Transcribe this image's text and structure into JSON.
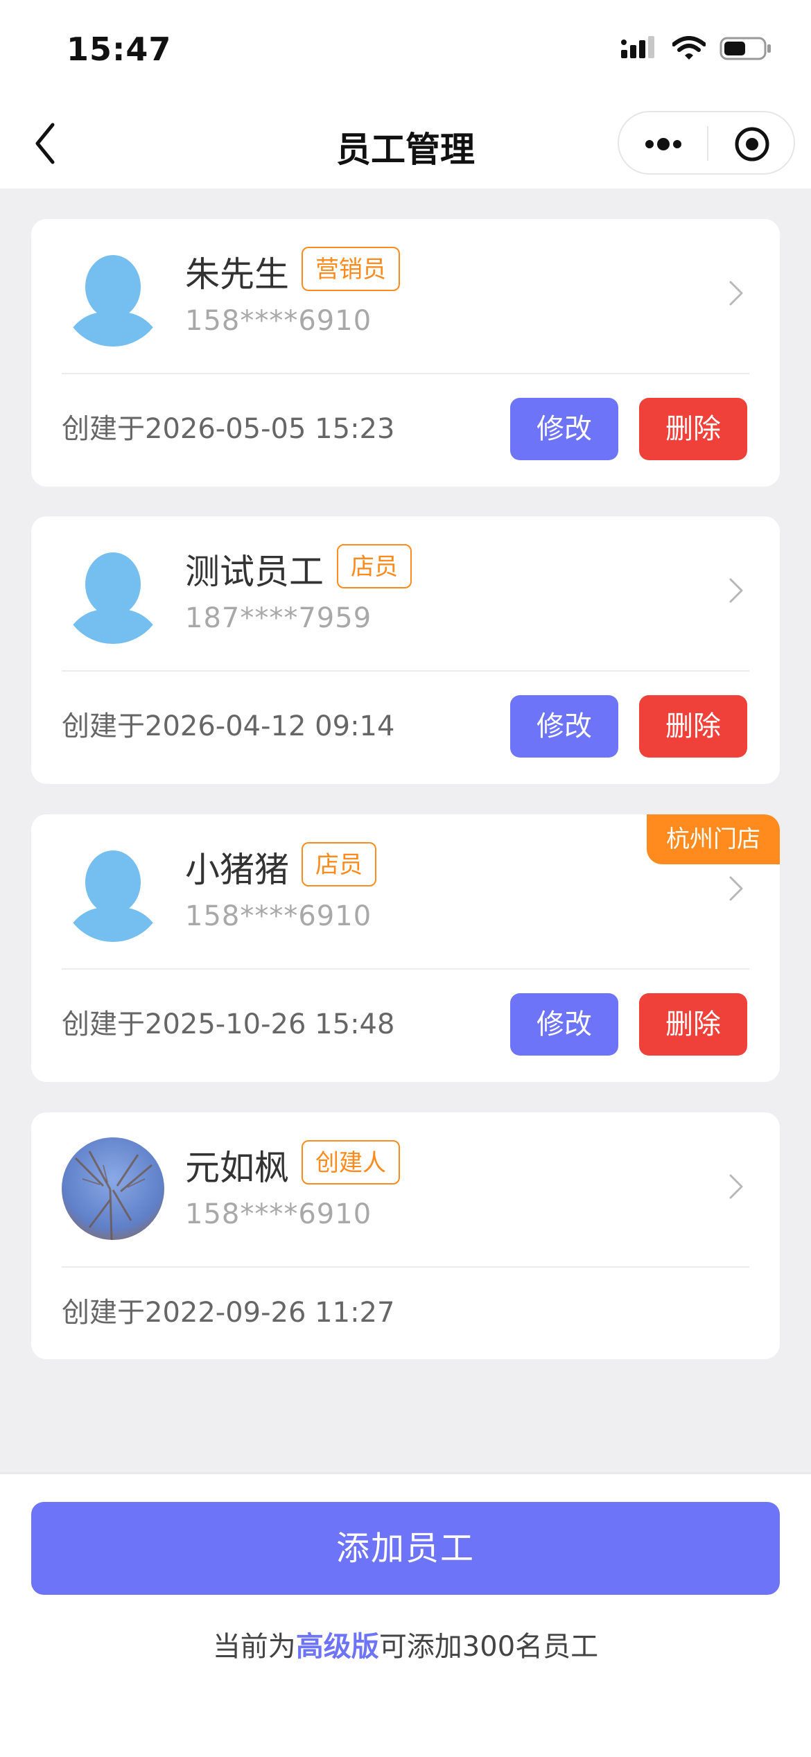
{
  "status": {
    "time": "15:47"
  },
  "nav": {
    "title": "员工管理"
  },
  "employees": [
    {
      "name": "朱先生",
      "role": "营销员",
      "phone": "158****6910",
      "created": "创建于2026-05-05 15:23",
      "edit_label": "修改",
      "delete_label": "删除"
    },
    {
      "name": "测试员工",
      "role": "店员",
      "phone": "187****7959",
      "created": "创建于2026-04-12 09:14",
      "edit_label": "修改",
      "delete_label": "删除"
    },
    {
      "name": "小猪猪",
      "role": "店员",
      "phone": "158****6910",
      "created": "创建于2025-10-26 15:48",
      "edit_label": "修改",
      "delete_label": "删除",
      "store_tag": "杭州门店"
    },
    {
      "name": "元如枫",
      "role": "创建人",
      "phone": "158****6910",
      "created": "创建于2022-09-26 11:27"
    }
  ],
  "footer": {
    "add_label": "添加员工",
    "plan_prefix": "当前为",
    "plan_name": "高级版",
    "plan_suffix": "可添加300名员工"
  },
  "colors": {
    "accent": "#6e74f8",
    "danger": "#f0403a",
    "badge": "#ff8b1f",
    "avatar": "#74bff0"
  }
}
